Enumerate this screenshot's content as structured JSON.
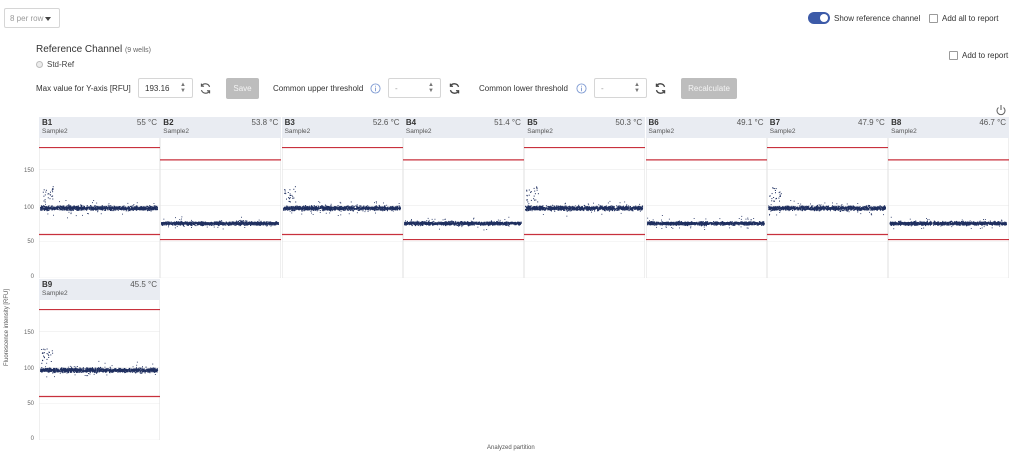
{
  "toolbar": {
    "per_row_label": "8 per row",
    "show_reference_label": "Show reference channel",
    "add_all_label": "Add all to report"
  },
  "header": {
    "title": "Reference Channel",
    "wells_count": "(9 wells)",
    "sample_option": "Std-Ref",
    "add_to_report_label": "Add to report"
  },
  "controls": {
    "max_y_label": "Max value for Y-axis [RFU]",
    "max_y_value": "193.16",
    "save_label": "Save",
    "upper_label": "Common upper threshold",
    "upper_value": "-",
    "lower_label": "Common lower threshold",
    "lower_value": "-",
    "recalculate_label": "Recalculate"
  },
  "axes": {
    "y_title": "Fluorescence intensity [RFU]",
    "x_title": "Analyzed partition",
    "y_ticks": [
      "150",
      "100",
      "50",
      "0"
    ]
  },
  "colors": {
    "points": "#1f2f5f",
    "threshold": "#c8313d",
    "header_bg": "#e9ecf2",
    "accent": "#3c5aa8"
  },
  "chart_data": {
    "type": "scatter",
    "xlabel": "Analyzed partition",
    "ylabel": "Fluorescence intensity [RFU]",
    "ylim": [
      0,
      193.16
    ],
    "y_ticks": [
      0,
      50,
      100,
      150
    ],
    "wells": [
      {
        "id": "B1",
        "temp": "55 °C",
        "sample": "Sample2",
        "upper": 180,
        "lower": 60,
        "center": 97
      },
      {
        "id": "B2",
        "temp": "53.8 °C",
        "sample": "Sample2",
        "upper": 163,
        "lower": 53,
        "center": 76
      },
      {
        "id": "B3",
        "temp": "52.6 °C",
        "sample": "Sample2",
        "upper": 180,
        "lower": 60,
        "center": 97
      },
      {
        "id": "B4",
        "temp": "51.4 °C",
        "sample": "Sample2",
        "upper": 163,
        "lower": 53,
        "center": 76
      },
      {
        "id": "B5",
        "temp": "50.3 °C",
        "sample": "Sample2",
        "upper": 180,
        "lower": 60,
        "center": 97
      },
      {
        "id": "B6",
        "temp": "49.1 °C",
        "sample": "Sample2",
        "upper": 163,
        "lower": 53,
        "center": 76
      },
      {
        "id": "B7",
        "temp": "47.9 °C",
        "sample": "Sample2",
        "upper": 180,
        "lower": 60,
        "center": 97
      },
      {
        "id": "B8",
        "temp": "46.7 °C",
        "sample": "Sample2",
        "upper": 163,
        "lower": 53,
        "center": 76
      },
      {
        "id": "B9",
        "temp": "45.5 °C",
        "sample": "Sample2",
        "upper": 180,
        "lower": 60,
        "center": 97
      }
    ]
  }
}
